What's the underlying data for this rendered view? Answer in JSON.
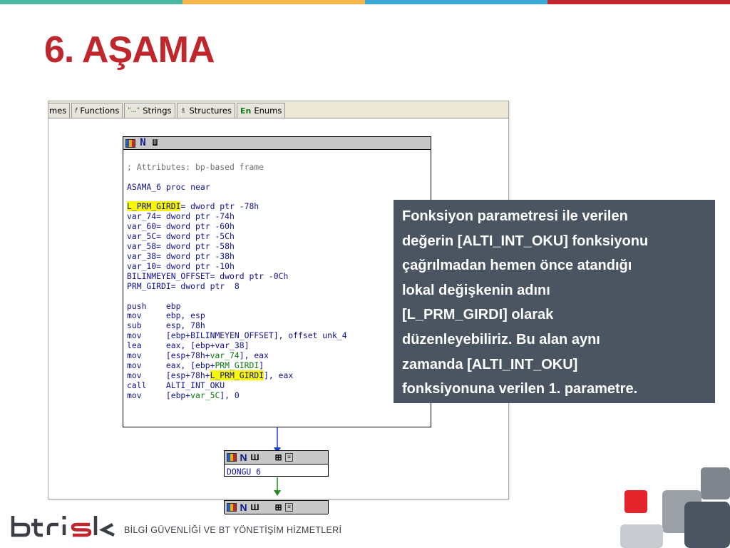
{
  "colors": {
    "stripe": [
      "#4cb8a4",
      "#f4b64a",
      "#3aa8d8",
      "#c0272d"
    ],
    "title": "#c0272d",
    "callout_bg": "#4a5561"
  },
  "slide": {
    "title": "6. AŞAMA"
  },
  "ida": {
    "tabs": [
      {
        "label": "mes",
        "icon": ""
      },
      {
        "label": "Functions",
        "icon": "functions-icon"
      },
      {
        "label": "Strings",
        "icon": "strings-icon"
      },
      {
        "label": "Structures",
        "icon": "structures-icon"
      },
      {
        "label": "Enums",
        "icon": "enums-icon"
      }
    ],
    "main_node": {
      "lines": [
        "; Attributes: bp-based frame",
        "ASAMA_6 proc near",
        "L_PRM_GIRDI= dword ptr -78h",
        "var_74= dword ptr -74h",
        "var_60= dword ptr -60h",
        "var_5C= dword ptr -5Ch",
        "var_58= dword ptr -58h",
        "var_38= dword ptr -38h",
        "var_10= dword ptr -10h",
        "BILINMEYEN_OFFSET= dword ptr -0Ch",
        "PRM_GIRDI= dword ptr  8",
        "push    ebp",
        "mov     ebp, esp",
        "sub     esp, 78h",
        "mov     [ebp+BILINMEYEN_OFFSET], offset unk_4",
        "lea     eax, [ebp+var_38]",
        "mov     [esp+78h+var_74], eax",
        "mov     eax, [ebp+PRM_GIRDI]",
        "mov     [esp+78h+L_PRM_GIRDI], eax",
        "call    ALTI_INT_OKU",
        "mov     [ebp+var_5C], 0"
      ]
    },
    "node2": {
      "label": "DONGU_6"
    }
  },
  "callout": {
    "lines": [
      "Fonksiyon parametresi ile verilen",
      "değerin [ALTI_INT_OKU] fonksiyonu",
      "çağrılmadan hemen önce atandığı",
      "lokal değişkenin adını",
      "[L_PRM_GIRDI] olarak",
      "düzenleyebiliriz. Bu alan aynı",
      "zamanda [ALTI_INT_OKU]",
      "fonksiyonuna verilen 1. parametre."
    ]
  },
  "brand": {
    "logo": "btrisk",
    "tagline": "BİLGİ GÜVENLİĞİ VE BT YÖNETİŞİM HİZMETLERİ"
  }
}
